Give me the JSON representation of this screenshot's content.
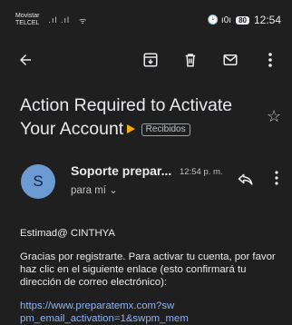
{
  "status_bar": {
    "carrier_line1": "Movistar",
    "carrier_line2": "TELCEL",
    "signal": ".ıl .ıl",
    "wifi": "ᯤ",
    "battery": "80",
    "time": "12:54",
    "status_icons": "🕑 ı0ı"
  },
  "subject": {
    "title": "Action Required to Activate Your Account",
    "label": "Recibidos"
  },
  "message": {
    "avatar_letter": "S",
    "sender": "Soporte prepar...",
    "time": "12:54 p. m.",
    "recipient": "para mí ⌄"
  },
  "body": {
    "greeting": "Estimad@ CINTHYA",
    "paragraph": "Gracias por registrarte. Para activar tu cuenta, por favor haz clic en el siguiente enlace (esto confirmará tu dirección de correo electrónico):",
    "link": "https://www.preparatemx.com?sw pm_email_activation=1&swpm_mem"
  }
}
